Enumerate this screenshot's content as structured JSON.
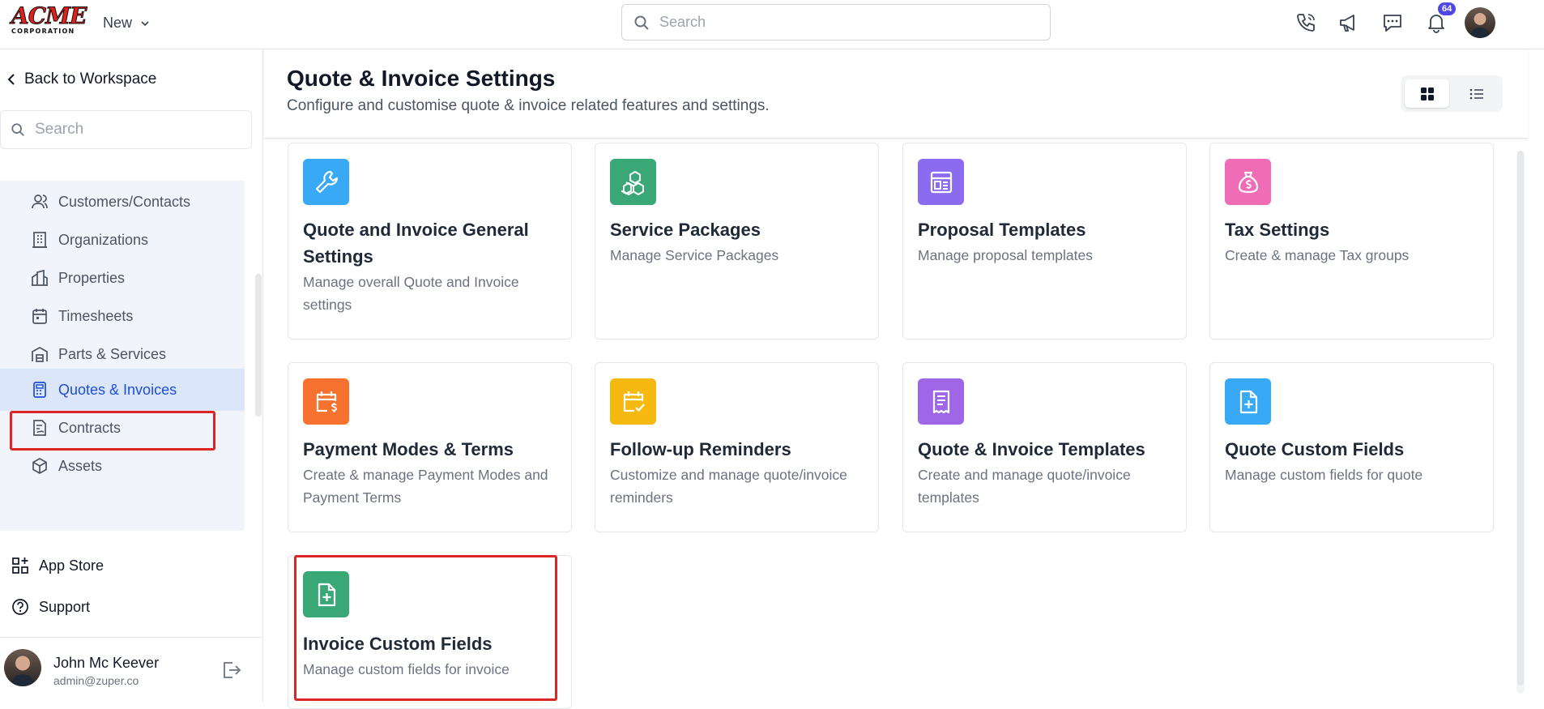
{
  "topbar": {
    "logo_text": "ACME",
    "logo_subtext": "CORPORATION",
    "new_label": "New",
    "search_placeholder": "Search",
    "notification_count": "64",
    "icons": [
      "phone-icon",
      "megaphone-icon",
      "chat-icon",
      "bell-icon"
    ]
  },
  "sidebar": {
    "back_label": "Back to Workspace",
    "search_placeholder": "Search",
    "items": [
      {
        "label": "Customers/Contacts",
        "icon": "users-icon"
      },
      {
        "label": "Organizations",
        "icon": "building-icon"
      },
      {
        "label": "Properties",
        "icon": "properties-icon"
      },
      {
        "label": "Timesheets",
        "icon": "calendar-icon"
      },
      {
        "label": "Parts & Services",
        "icon": "warehouse-icon"
      },
      {
        "label": "Quotes & Invoices",
        "icon": "calculator-icon",
        "active": true
      },
      {
        "label": "Contracts",
        "icon": "contract-icon"
      },
      {
        "label": "Assets",
        "icon": "cube-icon"
      }
    ],
    "app_store_label": "App Store",
    "support_label": "Support",
    "user": {
      "name": "John Mc Keever",
      "email": "admin@zuper.co"
    }
  },
  "page": {
    "title": "Quote & Invoice Settings",
    "subtitle": "Configure and customise quote & invoice related features and settings."
  },
  "cards": [
    {
      "title": "Quote and Invoice General Settings",
      "desc": "Manage overall Quote and Invoice settings",
      "color": "#38a9f5",
      "icon": "wrench-icon"
    },
    {
      "title": "Service Packages",
      "desc": "Manage Service Packages",
      "color": "#3aa776",
      "icon": "boxes-icon"
    },
    {
      "title": "Proposal Templates",
      "desc": "Manage proposal templates",
      "color": "#8b6cf1",
      "icon": "layout-icon"
    },
    {
      "title": "Tax Settings",
      "desc": "Create & manage Tax groups",
      "color": "#ee6db5",
      "icon": "money-bag-icon"
    },
    {
      "title": "Payment Modes & Terms",
      "desc": "Create & manage Payment Modes and Payment Terms",
      "color": "#f7722f",
      "icon": "calendar-dollar-icon"
    },
    {
      "title": "Follow-up Reminders",
      "desc": "Customize and manage quote/invoice reminders",
      "color": "#f5b90f",
      "icon": "calendar-check-icon"
    },
    {
      "title": "Quote & Invoice Templates",
      "desc": "Create and manage quote/invoice templates",
      "color": "#a066e8",
      "icon": "receipt-icon"
    },
    {
      "title": "Quote Custom Fields",
      "desc": "Manage custom fields for quote",
      "color": "#38a9f5",
      "icon": "file-plus-icon"
    },
    {
      "title": "Invoice Custom Fields",
      "desc": "Manage custom fields for invoice",
      "color": "#3aa776",
      "icon": "file-plus-icon"
    }
  ]
}
